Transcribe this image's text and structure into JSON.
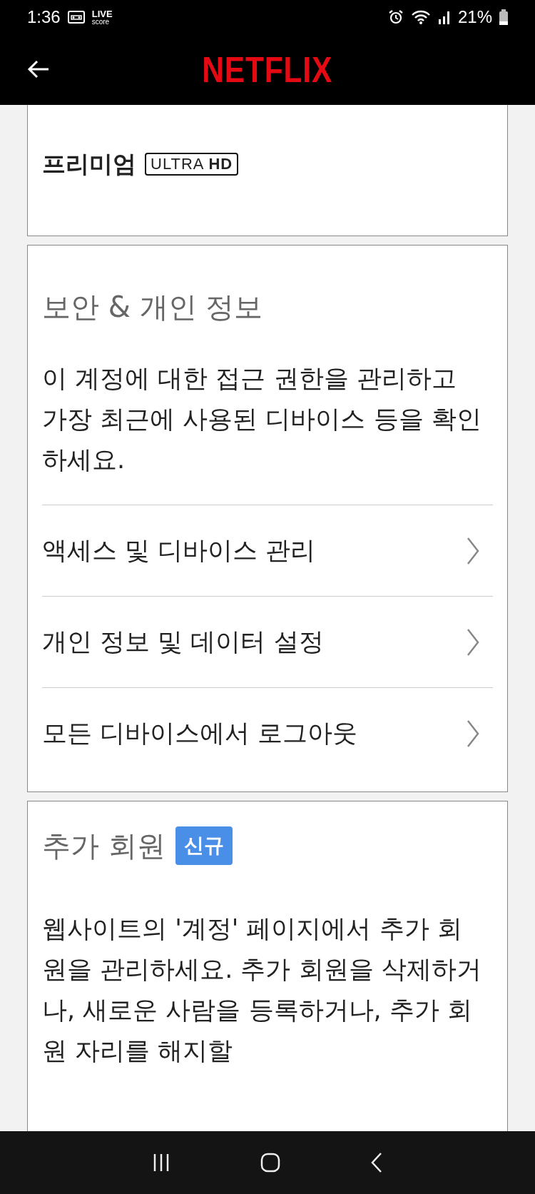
{
  "status_bar": {
    "time": "1:36",
    "app_badge": {
      "top": "LIVE",
      "bottom": "score"
    },
    "battery": "21%"
  },
  "header": {
    "logo": "NETFLIX"
  },
  "membership": {
    "plan": "프리미엄",
    "plan_badge": {
      "light": "ULTRA",
      "bold": "HD"
    }
  },
  "security": {
    "title": "보안 & 개인 정보",
    "description": "이 계정에 대한 접근 권한을 관리하고 가장 최근에 사용된 디바이스 등을 확인하세요.",
    "items": [
      {
        "label": "액세스 및 디바이스 관리"
      },
      {
        "label": "개인 정보 및 데이터 설정"
      },
      {
        "label": "모든 디바이스에서 로그아웃"
      }
    ]
  },
  "extra_members": {
    "title": "추가 회원",
    "badge": "신규",
    "description": "웹사이트의 '계정' 페이지에서 추가 회원을 관리하세요. 추가 회원을 삭제하거나, 새로운 사람을 등록하거나, 추가 회원 자리를 해지할"
  }
}
